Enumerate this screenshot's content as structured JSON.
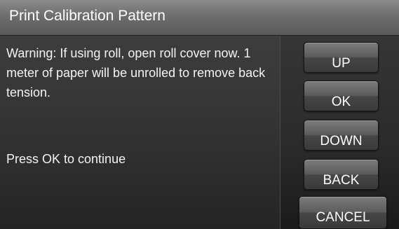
{
  "title": "Print Calibration Pattern",
  "message": {
    "warning": "Warning: If using roll, open roll cover now. 1 meter of paper will be unrolled to remove back tension.",
    "prompt": "Press OK to continue"
  },
  "buttons": {
    "up": "UP",
    "ok": "OK",
    "down": "DOWN",
    "back": "BACK",
    "cancel": "CANCEL"
  }
}
